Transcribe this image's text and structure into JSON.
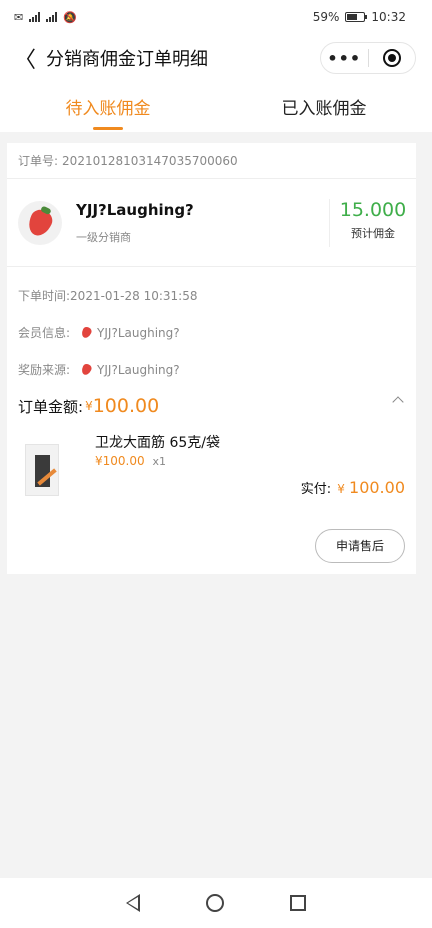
{
  "status_bar": {
    "left_text": "℡",
    "battery": "59%",
    "time": "10:32"
  },
  "header": {
    "back_label": "〈",
    "title": "分销商佣金订单明细",
    "more_label": "•••"
  },
  "tabs": [
    {
      "label": "待入账佣金",
      "active": true
    },
    {
      "label": "已入账佣金",
      "active": false
    }
  ],
  "order": {
    "order_no_label": "订单号:",
    "order_no": "20210128103147035700060",
    "distributor_name": "YJJ?Laughing?",
    "distributor_level": "一级分销商",
    "commission_value": "15.000",
    "commission_label": "预计佣金",
    "order_time_label": "下单时间:",
    "order_time": "2021-01-28 10:31:58",
    "member_label": "会员信息:",
    "member_name": "YJJ?Laughing?",
    "source_label": "奖励来源:",
    "source_name": "YJJ?Laughing?",
    "amount_label": "订单金额:",
    "currency": "¥",
    "amount_value": "100.00"
  },
  "product": {
    "name": "卫龙大面筋 65克/袋",
    "price": "¥100.00",
    "qty": "x1",
    "paid_label": "实付:",
    "paid_currency": "¥",
    "paid_value": "100.00"
  },
  "actions": {
    "after_sale_label": "申请售后"
  },
  "colors": {
    "accent": "#f08a1f",
    "commission": "#3fae4a"
  }
}
